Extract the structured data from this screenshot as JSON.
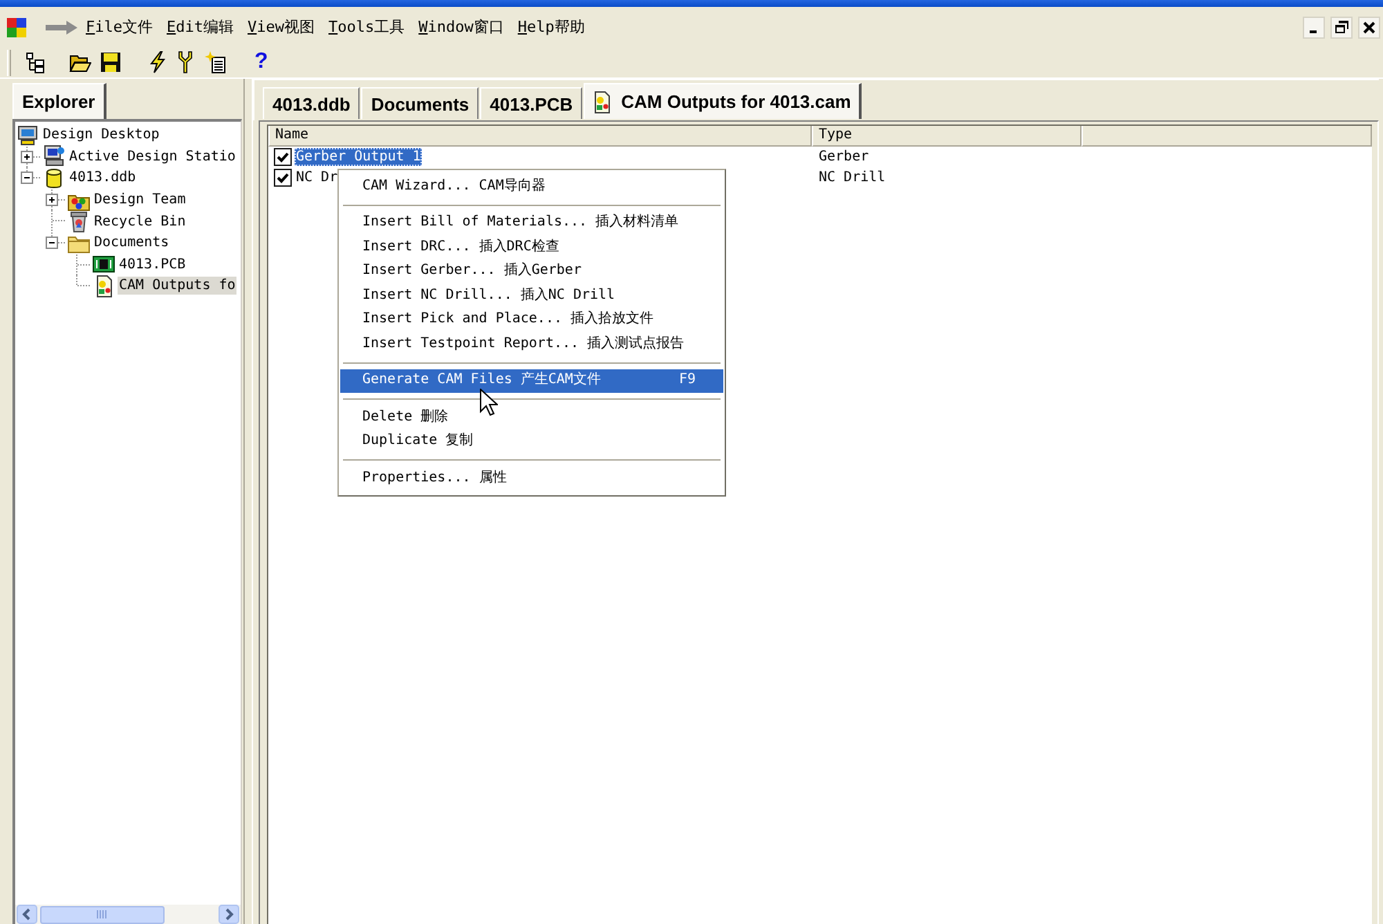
{
  "menu_bar": {
    "items": [
      "File文件",
      "Edit编辑",
      "View视图",
      "Tools工具",
      "Window窗口",
      "Help帮助"
    ]
  },
  "toolbar": {
    "help_label": "?"
  },
  "explorer": {
    "tabs": [
      {
        "label": "Explorer",
        "selected": true
      }
    ],
    "tree": [
      {
        "label": "Design Desktop",
        "kind": "desktop",
        "selected": false,
        "children": [
          {
            "label": "Active Design Statio",
            "kind": "station",
            "expanded": false,
            "selected": false
          },
          {
            "label": "4013.ddb",
            "kind": "database",
            "expanded": true,
            "selected": false,
            "children": [
              {
                "label": "Design Team",
                "kind": "team",
                "expanded": false,
                "selected": false
              },
              {
                "label": "Recycle Bin",
                "kind": "recycle",
                "selected": false
              },
              {
                "label": "Documents",
                "kind": "folder",
                "expanded": true,
                "selected": false,
                "children": [
                  {
                    "label": "4013.PCB",
                    "kind": "pcb",
                    "selected": false
                  },
                  {
                    "label": "CAM Outputs fo",
                    "kind": "cam",
                    "selected": true
                  }
                ]
              }
            ]
          }
        ]
      }
    ]
  },
  "doc_tabs": [
    {
      "label": "4013.ddb",
      "selected": false
    },
    {
      "label": "Documents",
      "selected": false
    },
    {
      "label": "4013.PCB",
      "selected": false
    },
    {
      "label": "CAM Outputs for 4013.cam",
      "selected": true
    }
  ],
  "list": {
    "columns": [
      "Name",
      "Type"
    ],
    "rows": [
      {
        "name": "Gerber Output 1",
        "type": "Gerber",
        "checked": true,
        "selected": true
      },
      {
        "name": "NC Dr",
        "type": "NC Drill",
        "checked": true,
        "selected": false
      }
    ]
  },
  "context_menu": {
    "items": [
      {
        "kind": "command",
        "label": "CAM Wizard... CAM导向器",
        "selected": false
      },
      {
        "kind": "separator"
      },
      {
        "kind": "command",
        "label": "Insert Bill of Materials... 插入材料清单",
        "selected": false
      },
      {
        "kind": "command",
        "label": "Insert DRC... 插入DRC检查",
        "selected": false
      },
      {
        "kind": "command",
        "label": "Insert Gerber... 插入Gerber",
        "selected": false
      },
      {
        "kind": "command",
        "label": "Insert NC Drill... 插入NC Drill",
        "selected": false
      },
      {
        "kind": "command",
        "label": "Insert Pick and Place... 插入拾放文件",
        "selected": false
      },
      {
        "kind": "command",
        "label": "Insert Testpoint Report... 插入测试点报告",
        "selected": false
      },
      {
        "kind": "separator"
      },
      {
        "kind": "command",
        "label": "Generate CAM Files 产生CAM文件",
        "shortcut": "F9",
        "selected": true
      },
      {
        "kind": "separator"
      },
      {
        "kind": "command",
        "label": "Delete 删除",
        "selected": false
      },
      {
        "kind": "command",
        "label": "Duplicate 复制",
        "selected": false
      },
      {
        "kind": "separator"
      },
      {
        "kind": "command",
        "label": "Properties... 属性",
        "selected": false
      }
    ]
  }
}
